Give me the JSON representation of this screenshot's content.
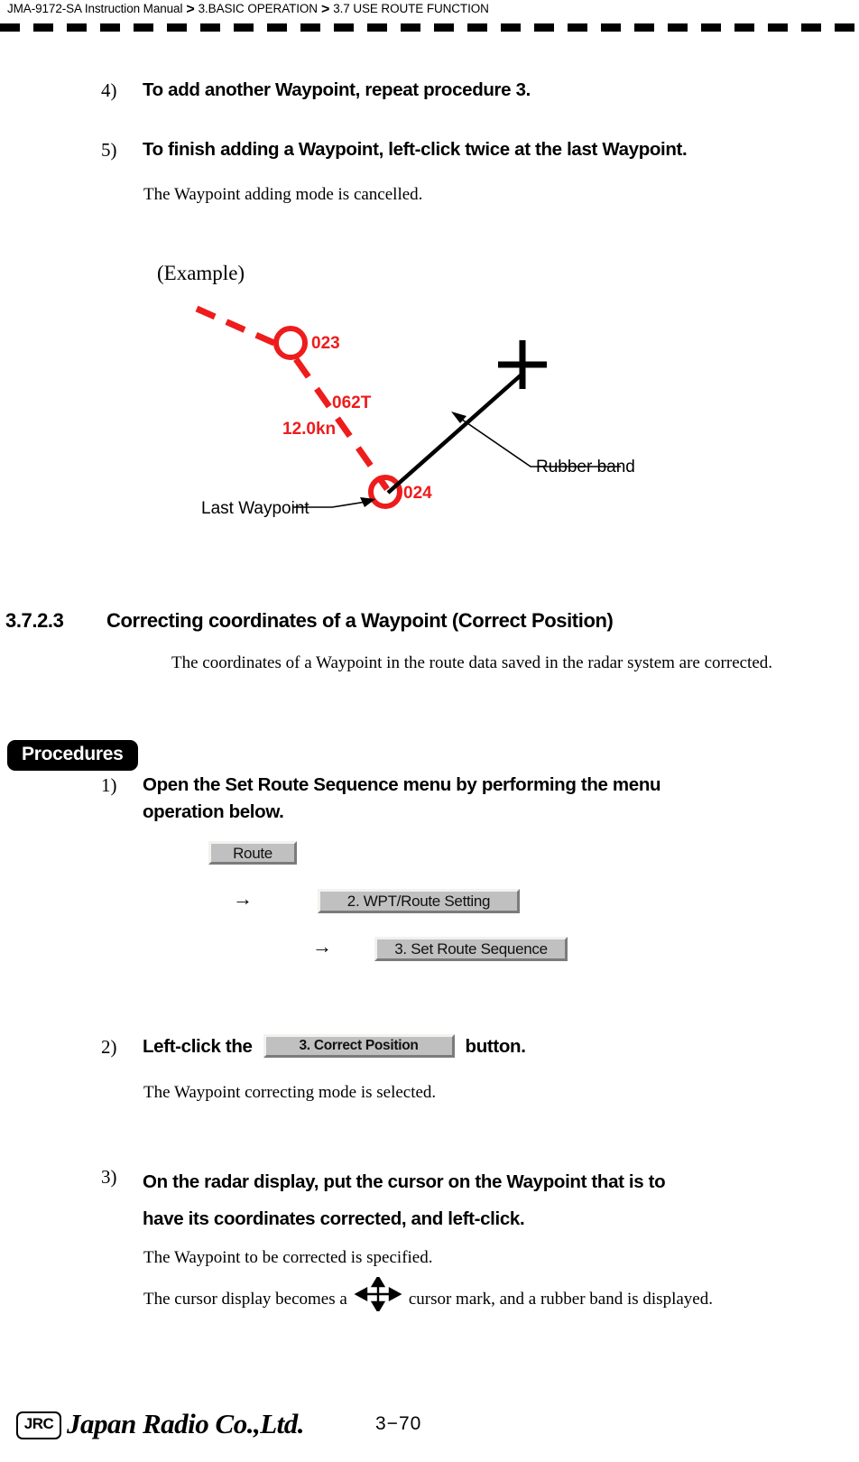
{
  "header": {
    "manual": "JMA-9172-SA Instruction Manual",
    "chapter": "3.BASIC OPERATION",
    "section": "3.7  USE ROUTE FUNCTION",
    "separator": ">"
  },
  "steps_top": [
    {
      "num": "4)",
      "text": "To add another Waypoint, repeat procedure 3."
    },
    {
      "num": "5)",
      "text": "To finish adding a Waypoint, left-click twice at the last Waypoint."
    }
  ],
  "notes": {
    "cancelled": "The Waypoint adding mode is cancelled.",
    "coords_corrected": "The coordinates of a Waypoint in the route data saved in the radar system are corrected.",
    "mode_selected": "The Waypoint correcting mode is selected.",
    "wpt_specified": "The Waypoint to be corrected is specified.",
    "cursor_becomes_pre": "The cursor display becomes a",
    "cursor_becomes_post": "cursor mark, and a rubber band is displayed."
  },
  "diagram": {
    "example_label": "(Example)",
    "waypoint_1": "023",
    "waypoint_2": "024",
    "bearing": "062T",
    "speed": "12.0kn",
    "rubber_band_label": "Rubber band",
    "last_waypoint_label": "Last Waypoint",
    "route_color": "#ee1c1c",
    "line_color": "#000000"
  },
  "section": {
    "number": "3.7.2.3",
    "title": "Correcting coordinates of a Waypoint (Correct Position)"
  },
  "procedures": {
    "badge": "Procedures",
    "steps": [
      {
        "num": "1)",
        "line1": "Open the Set Route Sequence menu by performing the menu",
        "line2": "operation below."
      },
      {
        "num": "2)",
        "pre": "Left-click the",
        "post": "button."
      },
      {
        "num": "3)",
        "line1": "On the radar display, put the cursor on the Waypoint that is to",
        "line2": "have its coordinates corrected, and left-click."
      }
    ],
    "menu_path": {
      "arrow": "→",
      "buttons": [
        "Route",
        "2. WPT/Route Setting",
        "3. Set Route Sequence"
      ],
      "correct_position": "3. Correct Position"
    }
  },
  "footer": {
    "logo_mark": "JRC",
    "company": "Japan Radio Co.,Ltd.",
    "page": "3−70"
  }
}
